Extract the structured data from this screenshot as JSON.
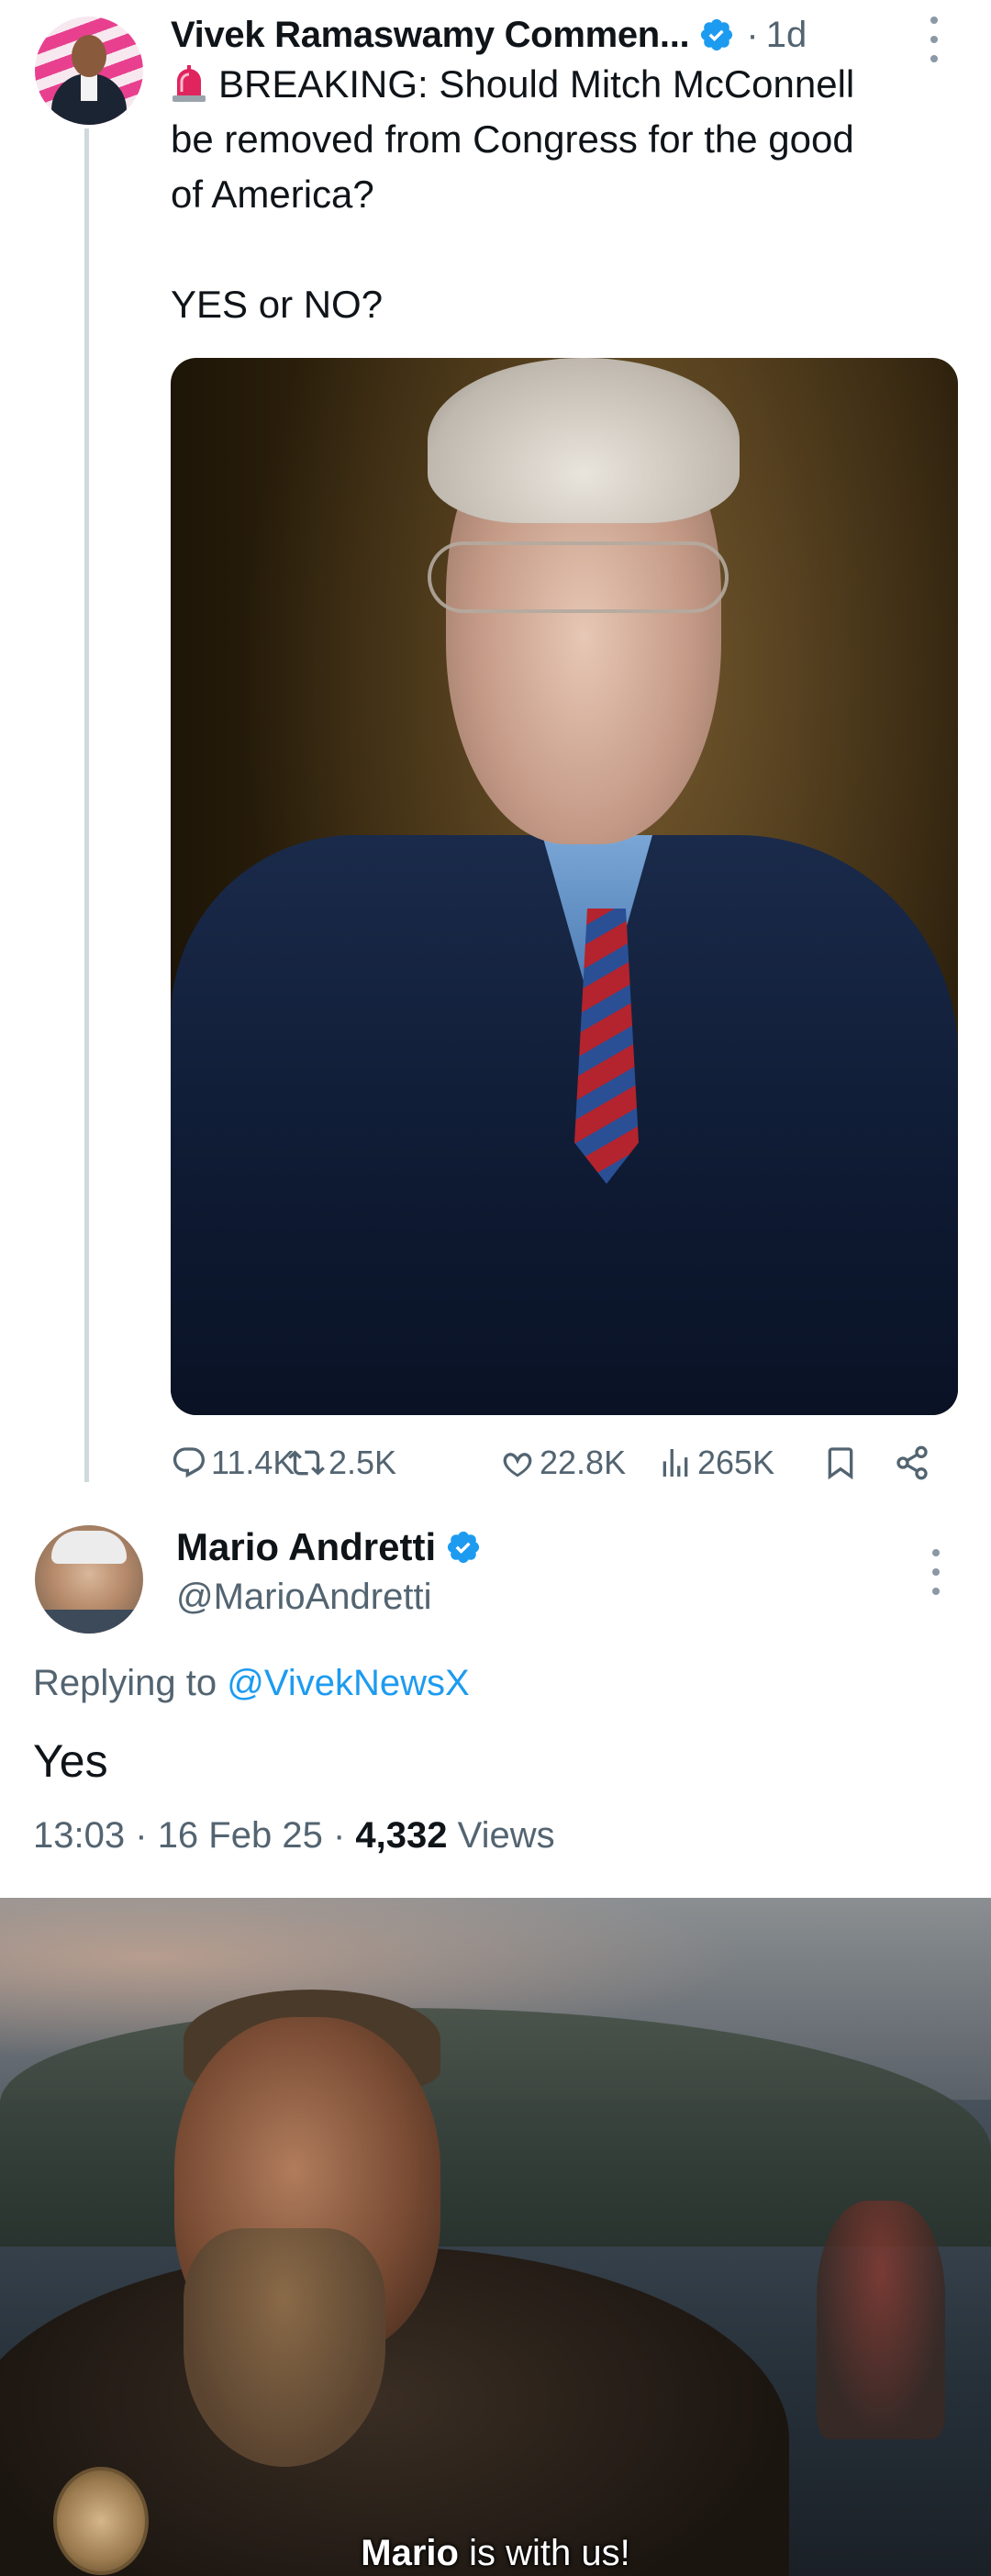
{
  "top_tweet": {
    "author_name": "Vivek Ramaswamy Commen...",
    "separator": "·",
    "time": "1d",
    "line1": "BREAKING: Should Mitch McConnell",
    "line2": "be removed from Congress for the good",
    "line3": "of America?",
    "question": "YES or NO?",
    "actions": {
      "replies": "11.4K",
      "reposts": "2.5K",
      "likes": "22.8K",
      "views": "265K"
    }
  },
  "reply_tweet": {
    "author_name": "Mario Andretti",
    "handle": "@MarioAndretti",
    "replying_label": "Replying to",
    "replying_mention": "@VivekNewsX",
    "text": "Yes",
    "time": "13:03",
    "date": "16 Feb 25",
    "views_count": "4,332",
    "views_label": "Views",
    "meta_sep": "·"
  },
  "meme": {
    "caption_bold": "Mario",
    "caption_rest": " is with us!"
  },
  "colors": {
    "verified_blue": "#1d9bf0",
    "text_primary": "#0f1419",
    "text_secondary": "#536471",
    "thread_line": "#cfd9de"
  },
  "icons": [
    "verified-badge-icon",
    "siren-icon",
    "more-icon",
    "reply-icon",
    "retweet-icon",
    "like-icon",
    "views-icon",
    "bookmark-icon",
    "share-icon"
  ]
}
